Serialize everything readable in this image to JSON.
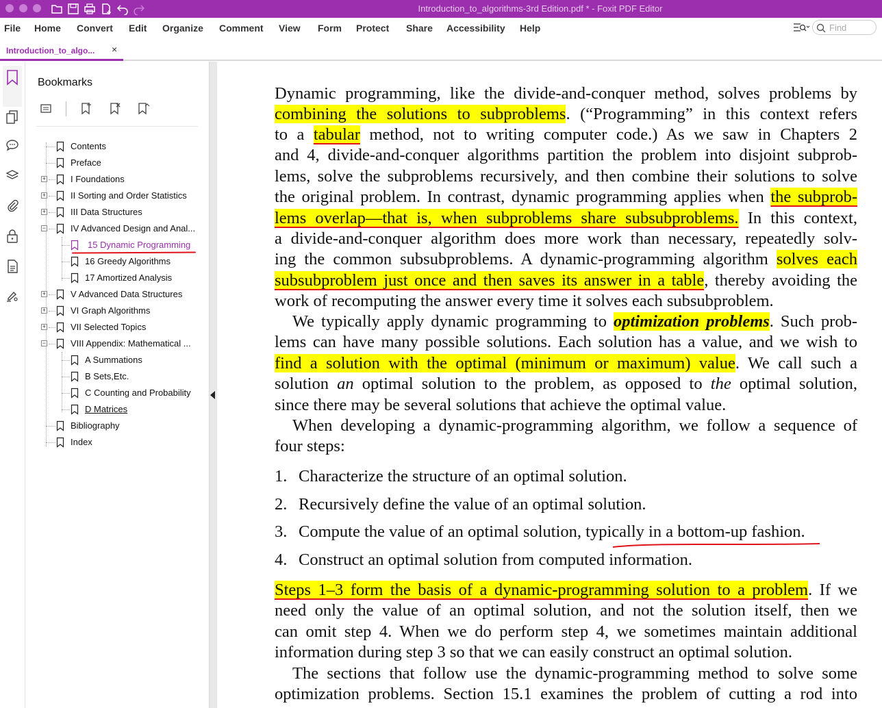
{
  "window": {
    "title": "Introduction_to_algorithms-3rd Edition.pdf * - Foxit PDF Editor"
  },
  "menu": [
    "File",
    "Home",
    "Convert",
    "Edit",
    "Organize",
    "Comment",
    "View",
    "Form",
    "Protect",
    "Share",
    "Accessibility",
    "Help"
  ],
  "search": {
    "placeholder": "Find"
  },
  "tab": {
    "label": "Introduction_to_algo...",
    "close": "×"
  },
  "bookmarks": {
    "title": "Bookmarks",
    "items": [
      {
        "label": "Contents"
      },
      {
        "label": "Preface"
      },
      {
        "label": "I Foundations"
      },
      {
        "label": "II Sorting and Order Statistics"
      },
      {
        "label": "III Data Structures"
      },
      {
        "label": "IV Advanced Design and Anal..."
      },
      {
        "label": "15 Dynamic Programming"
      },
      {
        "label": "16 Greedy Algorithms"
      },
      {
        "label": "17 Amortized Analysis"
      },
      {
        "label": "V Advanced Data Structures"
      },
      {
        "label": "VI Graph Algorithms"
      },
      {
        "label": "VII Selected Topics"
      },
      {
        "label": "VIII Appendix: Mathematical ..."
      },
      {
        "label": "A Summations"
      },
      {
        "label": "B Sets,Etc."
      },
      {
        "label": "C Counting and Probability"
      },
      {
        "label": "D Matrices"
      },
      {
        "label": "Bibliography"
      },
      {
        "label": "Index"
      }
    ]
  },
  "doc": {
    "p1": {
      "l1": "Dynamic programming, like the divide-and-conquer method, solves problems by",
      "l2a": "combining the solutions to subproblems",
      "l2b": ".  (“Programming” in this context refers",
      "l3a": "to a ",
      "l3b": "tabular",
      "l3c": " method, not to writing computer code.)  As we saw in Chapters 2",
      "l4": "and 4, divide-and-conquer algorithms partition the problem into disjoint subprob-",
      "l5": "lems, solve the subproblems recursively, and then combine their solutions to solve",
      "l6a": "the original problem. In contrast, dynamic programming applies when ",
      "l6b": "the subprob-",
      "l7a": "lems overlap—that is, when subproblems share subsubproblems.",
      "l7b": " In this context,",
      "l8": "a divide-and-conquer algorithm does more work than necessary, repeatedly solv-",
      "l9a": "ing the common subsubproblems. A dynamic-programming algorithm ",
      "l9b": "solves each",
      "l10a": "subsubproblem just once and then saves its answer in a table",
      "l10b": ", thereby avoiding the",
      "l11": "work of recomputing the answer every time it solves each subsubproblem."
    },
    "p2": {
      "l1a": "We typically apply dynamic programming to ",
      "l1b": "optimization problems",
      "l1c": ". Such prob-",
      "l2": "lems can have many possible solutions. Each solution has a value, and we wish to",
      "l3a": "find a solution with the optimal (minimum or maximum) value",
      "l3b": ".  We call such a",
      "l4a": "solution ",
      "l4b": "an",
      "l4c": " optimal solution to the problem, as opposed to ",
      "l4d": "the",
      "l4e": " optimal solution,",
      "l5": "since there may be several solutions that achieve the optimal value."
    },
    "p3": {
      "l1": "When developing a dynamic-programming algorithm, we follow a sequence of",
      "l2": "four steps:"
    },
    "steps": [
      {
        "num": "1.",
        "text": "Characterize the structure of an optimal solution."
      },
      {
        "num": "2.",
        "text": "Recursively define the value of an optimal solution."
      },
      {
        "num": "3.",
        "text": "Compute the value of an optimal solution, typically in a bottom-up fashion."
      },
      {
        "num": "4.",
        "text": "Construct an optimal solution from computed information."
      }
    ],
    "p4": {
      "l1a": "Steps 1–3 form the basis of a dynamic-programming solution to a problem",
      "l1b": ". If we",
      "l2": "need only the value of an optimal solution, and not the solution itself, then we",
      "l3": "can omit step 4.  When we do perform step 4, we sometimes maintain additional",
      "l4": "information during step 3 so that we can easily construct an optimal solution."
    },
    "p5": {
      "l1": "The sections that follow use the dynamic-programming method to solve some",
      "l2": "optimization problems.  Section 15.1 examines the problem of cutting a rod into"
    }
  },
  "colors": {
    "accent": "#9b2fae",
    "highlight": "#ffff00",
    "annotation_red": "#e0141b"
  }
}
